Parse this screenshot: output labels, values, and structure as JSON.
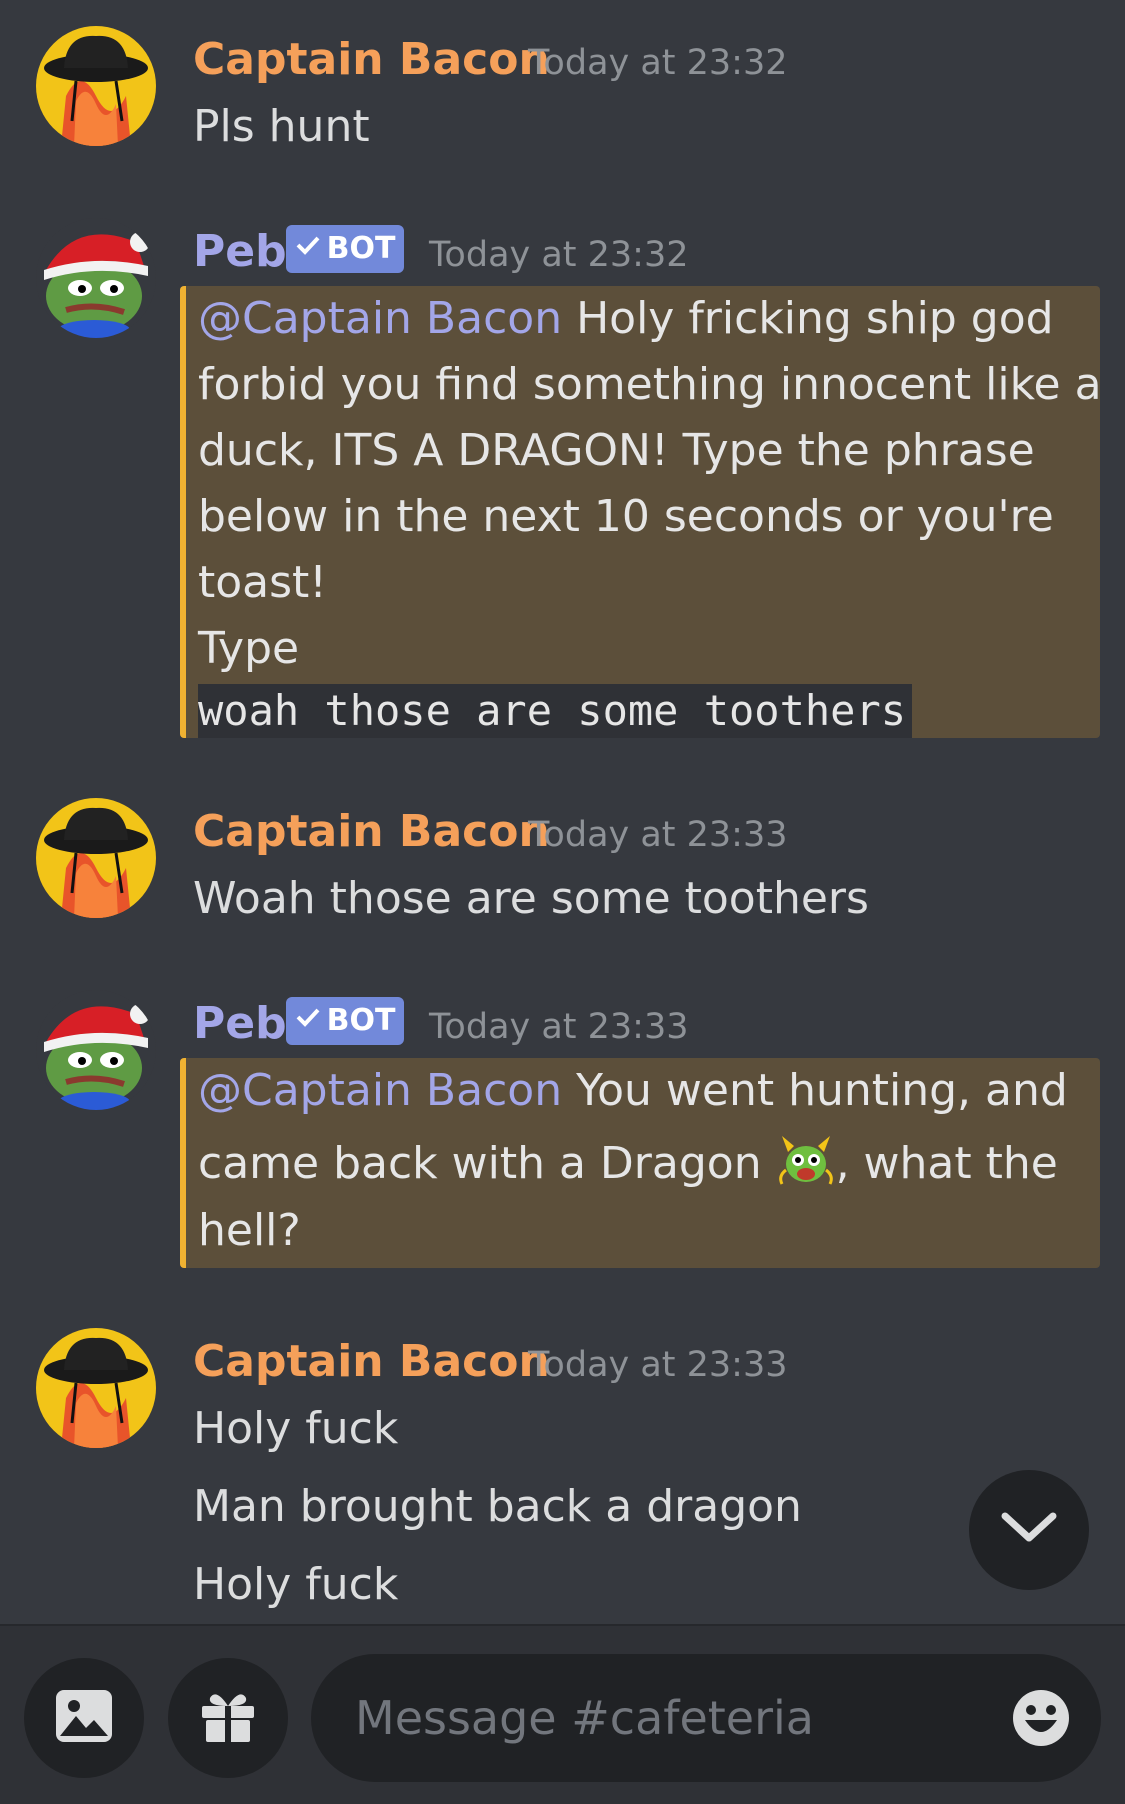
{
  "channel": "cafeteria",
  "colors": {
    "background": "#36393f",
    "author_orange": "#f5a05a",
    "bot_name": "#a3a6e8",
    "bot_badge": "#7289da",
    "mention_highlight": "#5c4f3a",
    "mention_bar": "#f0b232"
  },
  "messages": [
    {
      "author": "Captain Bacon",
      "timestamp": "Today at 23:32",
      "lines": [
        "Pls hunt"
      ]
    },
    {
      "author": "Peb",
      "badge": "BOT",
      "timestamp": "Today at 23:32",
      "mention": "@Captain Bacon",
      "lines": [
        " Holy fricking ship god",
        "forbid you find something innocent like a",
        "duck, ITS A DRAGON! Type the phrase",
        "below in the next 10 seconds or you're",
        "toast!",
        "Type"
      ],
      "code": "woah those are some toothers"
    },
    {
      "author": "Captain Bacon",
      "timestamp": "Today at 23:33",
      "lines": [
        "Woah those are some toothers"
      ]
    },
    {
      "author": "Peb",
      "badge": "BOT",
      "timestamp": "Today at 23:33",
      "mention": "@Captain Bacon",
      "lines": [
        " You went hunting, and",
        "came back with a Dragon",
        ", what the",
        "hell?"
      ],
      "emoji": "dragon-face-emoji"
    },
    {
      "author": "Captain Bacon",
      "timestamp": "Today at 23:33",
      "lines": [
        "Holy fuck",
        "Man brought back a dragon",
        "Holy fuck"
      ]
    }
  ],
  "composer": {
    "placeholder": "Message #cafeteria",
    "icons": [
      "image-icon",
      "gift-icon",
      "emoji-icon"
    ]
  },
  "jump_button_icon": "chevron-down-icon"
}
